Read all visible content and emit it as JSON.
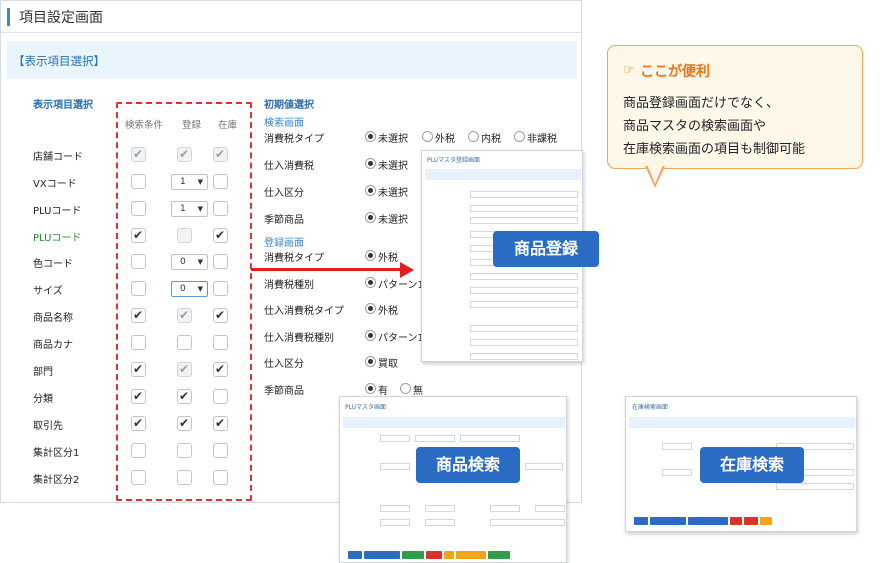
{
  "screen": {
    "title": "項目設定画面",
    "section": "【表示項目選択】",
    "left_head": "表示項目選択",
    "cols": [
      "検索条件",
      "登録",
      "在庫"
    ],
    "rows": [
      {
        "label": "店舗コード",
        "c1": "dis-ck",
        "c2": "dis-ck",
        "c3": "dis-ck",
        "sel": ""
      },
      {
        "label": "VXコード",
        "c1": "",
        "c2": "sel",
        "c3": "",
        "sel": "1"
      },
      {
        "label": "PLUコード",
        "c1": "",
        "c2": "sel",
        "c3": "",
        "sel": "1"
      },
      {
        "label": "PLUコード",
        "green": true,
        "c1": "ck",
        "c2": "dis",
        "c3": "ck",
        "sel": ""
      },
      {
        "label": "色コード",
        "c1": "",
        "c2": "sel",
        "c3": "",
        "sel": "0"
      },
      {
        "label": "サイズ",
        "c1": "",
        "c2": "sel-act",
        "c3": "",
        "sel": "0"
      },
      {
        "label": "商品名称",
        "c1": "ck",
        "c2": "dis-ck",
        "c3": "ck",
        "sel": ""
      },
      {
        "label": "商品カナ",
        "c1": "",
        "c2": "",
        "c3": "",
        "sel": ""
      },
      {
        "label": "部門",
        "c1": "ck",
        "c2": "dis-ck",
        "c3": "ck",
        "sel": ""
      },
      {
        "label": "分類",
        "c1": "ck",
        "c2": "ck",
        "c3": "",
        "sel": ""
      },
      {
        "label": "取引先",
        "c1": "ck",
        "c2": "ck",
        "c3": "ck",
        "sel": ""
      },
      {
        "label": "集計区分1",
        "c1": "",
        "c2": "",
        "c3": "",
        "sel": ""
      },
      {
        "label": "集計区分2",
        "c1": "",
        "c2": "",
        "c3": "",
        "sel": ""
      }
    ],
    "right_head": "初期値選択",
    "search_head": "検索画面",
    "register_head": "登録画面",
    "search_rows": [
      {
        "label": "消費税タイプ",
        "opts": [
          "未選択",
          "外税",
          "内税",
          "非課税"
        ],
        "on": 0
      },
      {
        "label": "仕入消費税",
        "opts": [
          "未選択"
        ],
        "on": 0
      },
      {
        "label": "仕入区分",
        "opts": [
          "未選択"
        ],
        "on": 0
      },
      {
        "label": "季節商品",
        "opts": [
          "未選択"
        ],
        "on": 0
      }
    ],
    "register_rows": [
      {
        "label": "消費税タイプ",
        "opts": [
          "外税"
        ],
        "on": 0
      },
      {
        "label": "消費税種別",
        "opts": [
          "パターン1"
        ],
        "on": 0
      },
      {
        "label": "仕入消費税タイプ",
        "opts": [
          "外税"
        ],
        "on": 0
      },
      {
        "label": "仕入消費税種別",
        "opts": [
          "パターン1"
        ],
        "on": 0
      },
      {
        "label": "仕入区分",
        "opts": [
          "買取"
        ],
        "on": 0
      },
      {
        "label": "季節商品",
        "opts": [
          "有",
          "無"
        ],
        "on": 0
      }
    ]
  },
  "callout": {
    "icon": "pointing-hand-icon",
    "title": "ここが便利",
    "lines": [
      "商品登録画面だけでなく、",
      "商品マスタの検索画面や",
      "在庫検索画面の項目も制御可能"
    ]
  },
  "badges": {
    "register": "商品登録",
    "search": "商品検索",
    "stock": "在庫検索"
  },
  "shots": {
    "register_title": "PLUマスタ登録画面",
    "search_title": "PLUマスタ画面",
    "stock_title": "在庫検索画面"
  },
  "colors": {
    "accent": "#2a6cc4",
    "dash": "#e03030",
    "callout_border": "#f5a35a",
    "callout_title": "#e8751a"
  }
}
